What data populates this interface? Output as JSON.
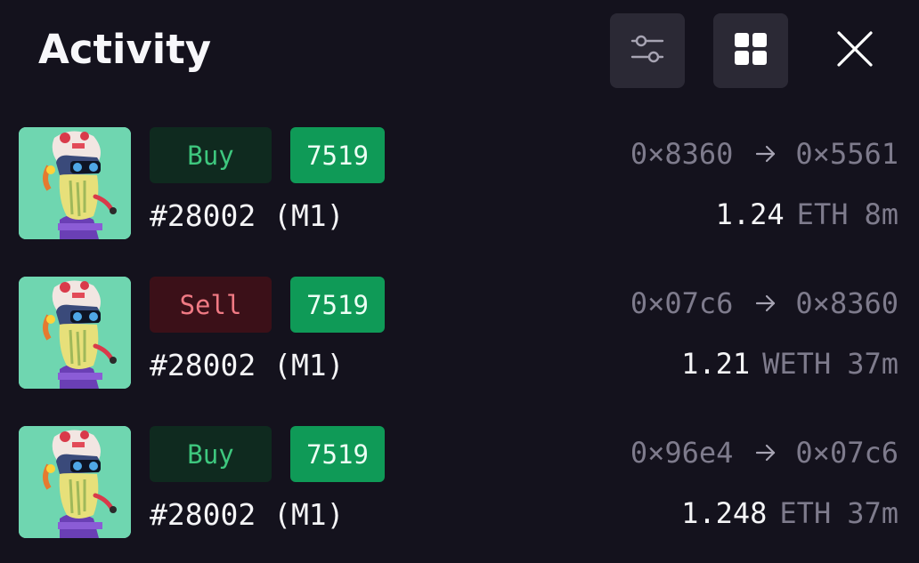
{
  "header": {
    "title": "Activity",
    "filter_icon": "sliders-icon",
    "grid_icon": "grid-icon",
    "close_icon": "close-icon"
  },
  "colors": {
    "background": "#14121d",
    "buy_bg": "#0f2a1f",
    "buy_text": "#3ec77e",
    "sell_bg": "#3b1018",
    "sell_text": "#f07a84",
    "token_bg": "#0f9a57",
    "muted_text": "#7e7b8c"
  },
  "activity": [
    {
      "type": "Buy",
      "token": "7519",
      "item": "#28002 (M1)",
      "from": "0×8360",
      "to": "0×5561",
      "amount": "1.24",
      "currency": "ETH",
      "age": "8m"
    },
    {
      "type": "Sell",
      "token": "7519",
      "item": "#28002 (M1)",
      "from": "0×07c6",
      "to": "0×8360",
      "amount": "1.21",
      "currency": "WETH",
      "age": "37m"
    },
    {
      "type": "Buy",
      "token": "7519",
      "item": "#28002 (M1)",
      "from": "0×96e4",
      "to": "0×07c6",
      "amount": "1.248",
      "currency": "ETH",
      "age": "37m"
    }
  ]
}
